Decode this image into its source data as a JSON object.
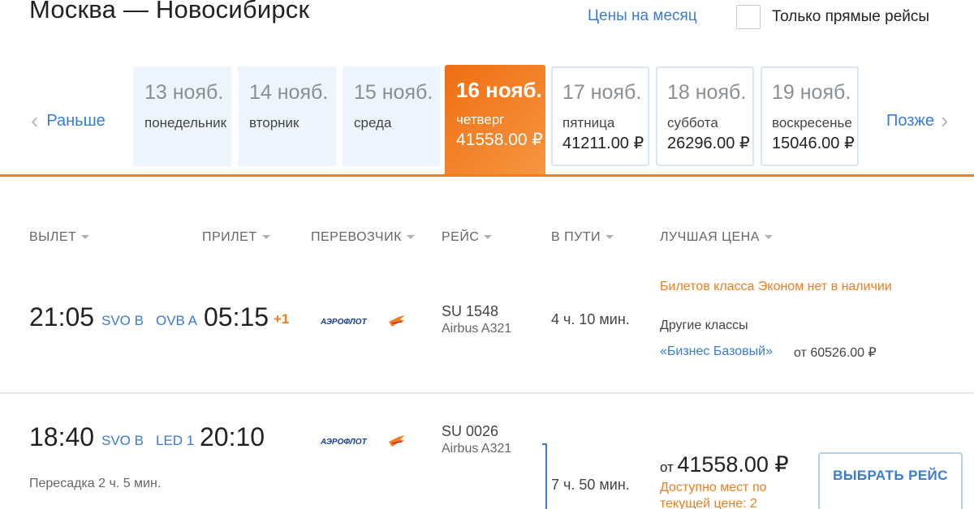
{
  "header": {
    "route": "Москва — Новосибирск",
    "month_prices_link": "Цены на месяц",
    "direct_only_label": "Только прямые рейсы"
  },
  "calendar": {
    "prev_label": "Раньше",
    "next_label": "Позже",
    "days": [
      {
        "date": "13 нояб.",
        "weekday": "понедельник",
        "price": ""
      },
      {
        "date": "14 нояб.",
        "weekday": "вторник",
        "price": ""
      },
      {
        "date": "15 нояб.",
        "weekday": "среда",
        "price": ""
      },
      {
        "date": "16 нояб.",
        "weekday": "четверг",
        "price": "41558.00 ₽"
      },
      {
        "date": "17 нояб.",
        "weekday": "пятница",
        "price": "41211.00 ₽"
      },
      {
        "date": "18 нояб.",
        "weekday": "суббота",
        "price": "26296.00 ₽"
      },
      {
        "date": "19 нояб.",
        "weekday": "воскресенье",
        "price": "15046.00 ₽"
      }
    ],
    "active_index": 3
  },
  "table": {
    "columns": [
      "ВЫЛЕТ",
      "ПРИЛЕТ",
      "ПЕРЕВОЗЧИК",
      "РЕЙС",
      "В ПУТИ",
      "ЛУЧШАЯ ЦЕНА"
    ]
  },
  "flights": [
    {
      "dep_time": "21:05",
      "dep_airport": "SVO B",
      "arr_airport": "OVB A",
      "arr_time": "05:15",
      "day_shift": "+1",
      "carrier": "АЭРОФЛОТ",
      "flight_no": "SU 1548",
      "aircraft": "Airbus A321",
      "duration": "4 ч. 10 мин.",
      "economy_note": "Билетов класса Эконом нет в наличии",
      "other_classes": "Другие классы",
      "class_link": "«Бизнес Базовый»",
      "class_price": "от 60526.00 ₽"
    },
    {
      "dep_time": "18:40",
      "dep_airport": "SVO B",
      "arr_airport": "LED 1",
      "arr_time": "20:10",
      "carrier": "АЭРОФЛОТ",
      "flight_no": "SU 0026",
      "aircraft": "Airbus A321",
      "duration": "7 ч. 50 мин.",
      "transfer": "Пересадка 2 ч. 5 мин.",
      "price_prefix": "от",
      "price": "41558.00 ₽",
      "seats_note": "Доступно мест по текущей цене: 2",
      "select_label": "ВЫБРАТЬ РЕЙС"
    }
  ],
  "colors": {
    "accent": "#f07d1e",
    "link": "#3a7bd5",
    "day_bg": "#eef5fd"
  }
}
